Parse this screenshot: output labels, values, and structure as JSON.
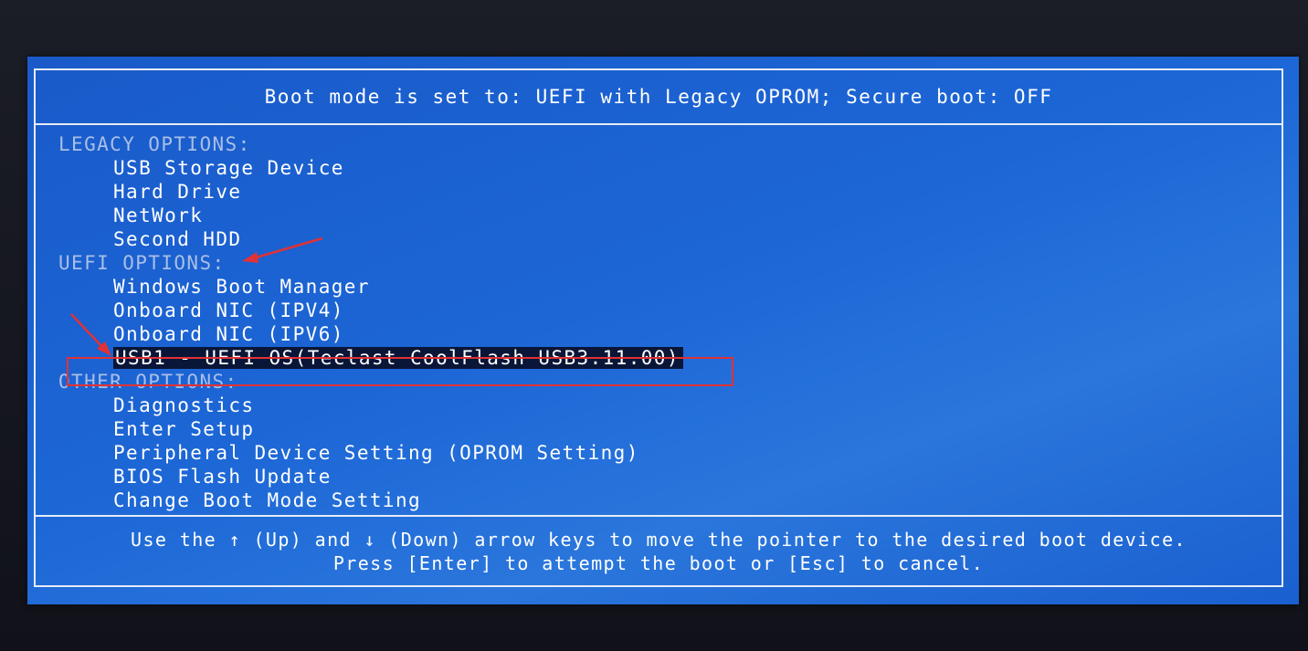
{
  "header": {
    "title": "Boot mode is set to: UEFI with Legacy OPROM; Secure boot: OFF"
  },
  "sections": [
    {
      "label": "LEGACY OPTIONS:",
      "items": [
        "USB Storage Device",
        "Hard Drive",
        "NetWork",
        "Second HDD"
      ]
    },
    {
      "label": "UEFI OPTIONS:",
      "items": [
        "Windows Boot Manager",
        "Onboard NIC (IPV4)",
        "Onboard NIC (IPV6)",
        "USB1 - UEFI OS(Teclast CoolFlash USB3.11.00)"
      ]
    },
    {
      "label": "OTHER OPTIONS:",
      "items": [
        "Diagnostics",
        "Enter Setup",
        "Peripheral Device Setting (OPROM Setting)",
        "BIOS Flash Update",
        "Change Boot Mode Setting"
      ]
    }
  ],
  "selected_item": "USB1 - UEFI OS(Teclast CoolFlash USB3.11.00)",
  "footer": {
    "line1": "Use the ↑ (Up) and ↓ (Down) arrow keys to move the pointer to the desired boot device.",
    "line2": "Press [Enter] to attempt the boot or [Esc] to cancel."
  },
  "colors": {
    "background": "#1c66d6",
    "selection": "#0a1638",
    "annotation": "#e03236"
  }
}
